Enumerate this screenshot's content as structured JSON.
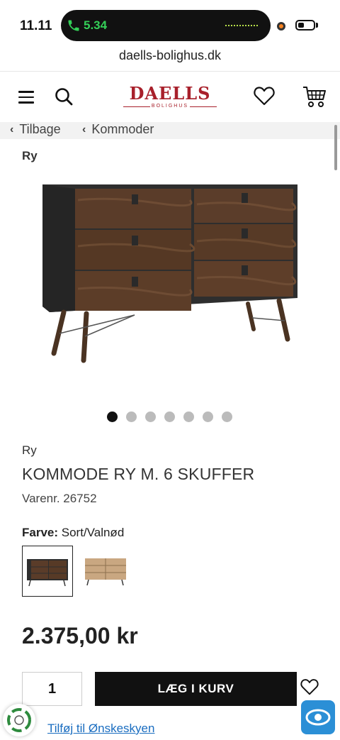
{
  "status": {
    "time": "11.11",
    "call_duration": "5.34"
  },
  "browser": {
    "url": "daells-bolighus.dk"
  },
  "header": {
    "logo_main": "DAELLS",
    "logo_sub": "BOLIGHUS"
  },
  "breadcrumbs": {
    "back_label": "Tilbage",
    "category_label": "Kommoder"
  },
  "brand_top": "Ry",
  "gallery": {
    "image_count": 7,
    "active_index": 0
  },
  "product": {
    "brand": "Ry",
    "title": "KOMMODE RY M. 6 SKUFFER",
    "sku": "Varenr. 26752",
    "color_label": "Farve:",
    "color_value": "Sort/Valnød",
    "price": "2.375,00 kr",
    "quantity": "1",
    "add_to_cart_label": "LÆG I KURV",
    "wishlist_link": "Tilføj til Ønskeskyen"
  },
  "colors": {
    "brand_red": "#a8202b",
    "button_black": "#111111",
    "link_blue": "#1a6dc0",
    "badge_blue": "#2b8fd6"
  }
}
